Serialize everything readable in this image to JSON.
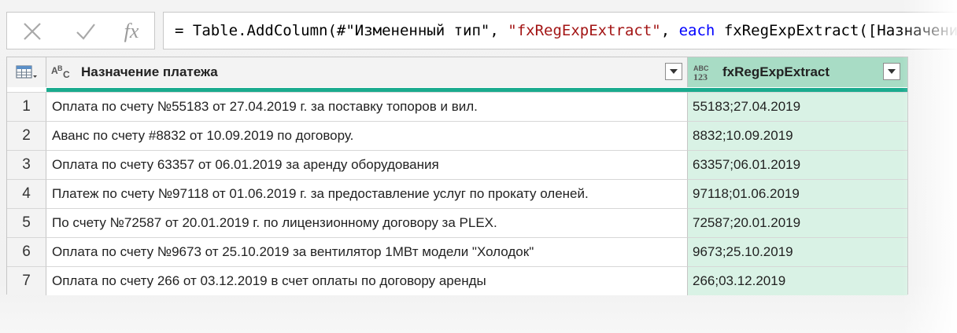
{
  "formula_bar": {
    "cancel_icon": "close-icon",
    "commit_icon": "checkmark-icon",
    "fx_label": "fx",
    "formula_parts": {
      "p1": "= Table.AddColumn(#\"Измененный тип\", ",
      "p2": "\"fxRegExpExtract\"",
      "p3": ", ",
      "p4": "each",
      "p5": " fxRegExpExtract([Назначение платежа]"
    }
  },
  "grid": {
    "corner_icon": "table-menu-icon",
    "columns": [
      {
        "type_icon": "text-type-icon",
        "type_icon_text": "ABC",
        "label": "Назначение платежа"
      },
      {
        "type_icon": "any-type-icon",
        "type_icon_text_top": "ABC",
        "type_icon_text_bottom": "123",
        "label": "fxRegExpExtract"
      }
    ],
    "rows": [
      {
        "n": "1",
        "text": "Оплата по счету №55183 от 27.04.2019 г. за поставку топоров и вил.",
        "result": "55183;27.04.2019"
      },
      {
        "n": "2",
        "text": "Аванс по счету #8832 от 10.09.2019 по договору.",
        "result": "8832;10.09.2019"
      },
      {
        "n": "3",
        "text": "Оплата по счету 63357 от 06.01.2019 за аренду оборудования",
        "result": "63357;06.01.2019"
      },
      {
        "n": "4",
        "text": "Платеж по счету №97118 от 01.06.2019 г. за предоставление услуг по прокату оленей.",
        "result": "97118;01.06.2019"
      },
      {
        "n": "5",
        "text": "По счету №72587 от 20.01.2019 г. по лицензионному договору за PLEX.",
        "result": "72587;20.01.2019"
      },
      {
        "n": "6",
        "text": "Оплата по счету №9673 от 25.10.2019 за вентилятор 1МВт модели \"Холодок\"",
        "result": "9673;25.10.2019"
      },
      {
        "n": "7",
        "text": "Оплата по счету 266 от 03.12.2019 в счет оплаты по договору аренды",
        "result": "266;03.12.2019"
      }
    ]
  },
  "colors": {
    "selected_header": "#a8dcc5",
    "selected_cells": "#d9f2e5",
    "accent_bar": "#1aab8e",
    "string_token": "#a31515",
    "keyword_token": "#0000ff"
  }
}
